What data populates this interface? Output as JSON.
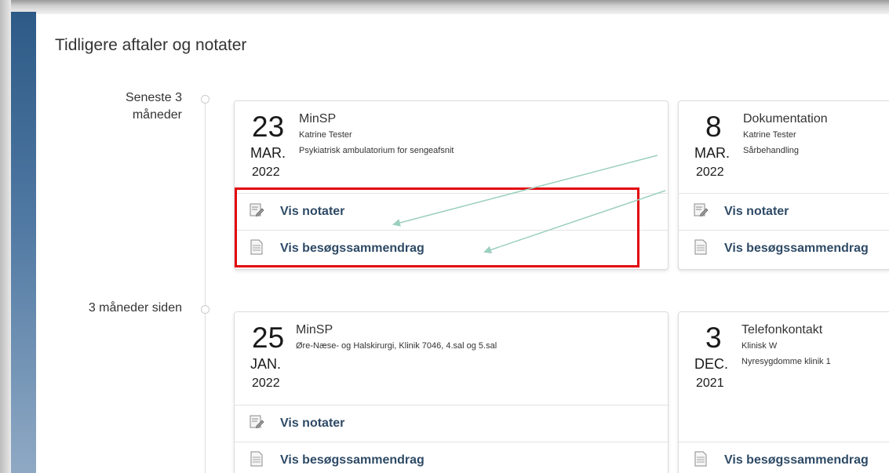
{
  "page": {
    "title": "Tidligere aftaler og notater"
  },
  "timeline": {
    "periods": [
      {
        "label_line1": "Seneste 3",
        "label_line2": "måneder"
      },
      {
        "label_line1": "3 måneder siden",
        "label_line2": ""
      }
    ]
  },
  "cards": [
    {
      "day": "23",
      "month": "MAR.",
      "year": "2022",
      "type": "MinSP",
      "meta1": "Katrine Tester",
      "meta2": "Psykiatrisk ambulatorium for sengeafsnit",
      "notes_label": "Vis notater",
      "summary_label": "Vis besøgssammendrag"
    },
    {
      "day": "8",
      "month": "MAR.",
      "year": "2022",
      "type": "Dokumentation",
      "meta1": "Katrine Tester",
      "meta2": "Sårbehandling",
      "notes_label": "Vis notater",
      "summary_label": "Vis besøgssammendrag"
    },
    {
      "day": "25",
      "month": "JAN.",
      "year": "2022",
      "type": "MinSP",
      "meta1": "Øre-Næse- og Halskirurgi, Klinik 7046, 4.sal og 5.sal",
      "meta2": "",
      "notes_label": "Vis notater",
      "summary_label": "Vis besøgssammendrag"
    },
    {
      "day": "3",
      "month": "DEC.",
      "year": "2021",
      "type": "Telefonkontakt",
      "meta1": "Klinisk W",
      "meta2": "Nyresygdomme klinik 1",
      "notes_label": "",
      "summary_label": "Vis besøgssammendrag"
    }
  ],
  "icons": {
    "notes": "notes-pencil-icon",
    "summary": "document-icon"
  },
  "colors": {
    "sidebar": "#2d5a87",
    "link": "#2e4a66",
    "highlight": "#e3060b",
    "arrow": "#9ccfc0"
  }
}
